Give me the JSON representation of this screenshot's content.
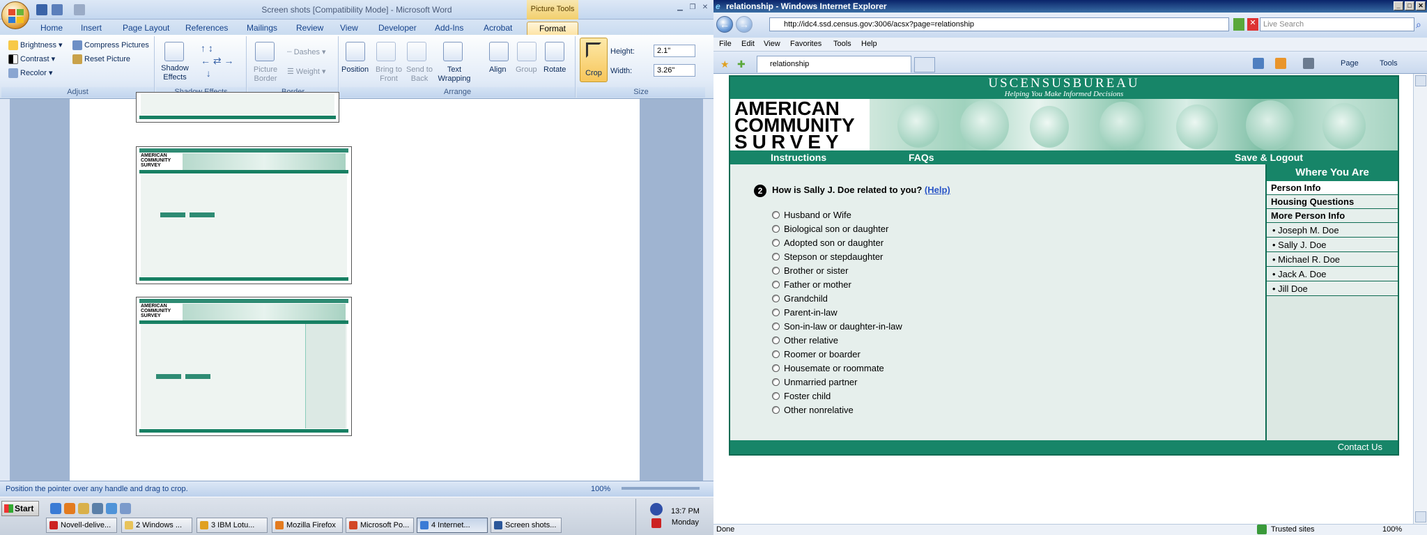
{
  "word": {
    "title": "Screen shots [Compatibility Mode] - Microsoft Word",
    "picture_tools_label": "Picture Tools",
    "tabs": [
      "Home",
      "Insert",
      "Page Layout",
      "References",
      "Mailings",
      "Review",
      "View",
      "Developer",
      "Add-Ins",
      "Acrobat",
      "Format"
    ],
    "active_tab": "Format",
    "adjust": {
      "brightness": "Brightness",
      "contrast": "Contrast",
      "recolor": "Recolor",
      "compress": "Compress Pictures",
      "reset": "Reset Picture",
      "label": "Adjust"
    },
    "shadow": {
      "effects": "Shadow Effects",
      "label": "Shadow Effects"
    },
    "border": {
      "picture_border": "Picture Border",
      "dashes": "Dashes",
      "weight": "Weight",
      "label": "Border"
    },
    "arrange": {
      "position": "Position",
      "bring_to_front": "Bring to Front",
      "send_to_back": "Send to Back",
      "text_wrapping": "Text Wrapping",
      "align": "Align",
      "group": "Group",
      "rotate": "Rotate",
      "label": "Arrange"
    },
    "size": {
      "crop": "Crop",
      "height_label": "Height:",
      "height_value": "2.1\"",
      "width_label": "Width:",
      "width_value": "3.26\"",
      "label": "Size"
    },
    "status_text": "Position the pointer over any handle and drag to crop.",
    "zoom": "100%"
  },
  "thumbs": {
    "logo": "AMERICAN COMMUNITY SURVEY"
  },
  "ie": {
    "title": "relationship - Windows Internet Explorer",
    "url": "http://idc4.ssd.census.gov:3006/acsx?page=relationship",
    "search_placeholder": "Live Search",
    "menu": [
      "File",
      "Edit",
      "View",
      "Favorites",
      "Tools",
      "Help"
    ],
    "tab_title": "relationship",
    "toolbar": {
      "page": "Page",
      "tools": "Tools"
    },
    "status_left": "Done",
    "status_zone": "Trusted sites",
    "status_zoom": "100%"
  },
  "acs": {
    "bureau": "USCENSUSBUREAU",
    "tagline": "Helping You Make Informed Decisions",
    "logo_lines": [
      "AMERICAN",
      "COMMUNITY",
      "SURVEY"
    ],
    "nav": {
      "instructions": "Instructions",
      "faqs": "FAQs",
      "save_logout": "Save & Logout"
    },
    "question_number": "2",
    "question": "How is Sally J. Doe related to you?",
    "help": "(Help)",
    "options": [
      "Husband or Wife",
      "Biological son or daughter",
      "Adopted son or daughter",
      "Stepson or stepdaughter",
      "Brother or sister",
      "Father or mother",
      "Grandchild",
      "Parent-in-law",
      "Son-in-law or daughter-in-law",
      "Other relative",
      "Roomer or boarder",
      "Housemate or roommate",
      "Unmarried partner",
      "Foster child",
      "Other nonrelative"
    ],
    "sidebar": {
      "heading": "Where You Are",
      "items": [
        "Person Info",
        "Housing Questions",
        "More Person Info"
      ],
      "people": [
        "• Joseph M. Doe",
        "• Sally J. Doe",
        "• Michael R. Doe",
        "• Jack A. Doe",
        "• Jill Doe"
      ]
    },
    "contact": "Contact Us"
  },
  "taskbar": {
    "start": "Start",
    "tasks": [
      "Novell-delive...",
      "2 Windows ...",
      "3 IBM Lotu...",
      "Mozilla Firefox",
      "Microsoft Po...",
      "4 Internet...",
      "Screen shots..."
    ],
    "active_task": "4 Internet...",
    "time": "13:7 PM",
    "day": "Monday"
  },
  "colors": {
    "acs_green": "#178568",
    "ribbon_blue": "#15428b",
    "ie_title": "#0a246a"
  }
}
